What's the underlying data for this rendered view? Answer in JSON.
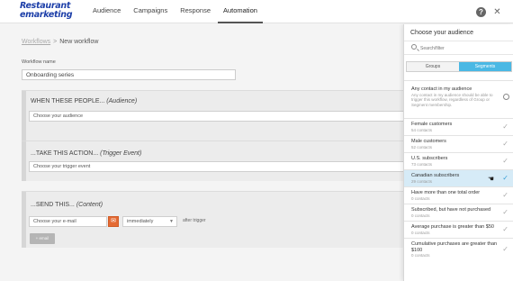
{
  "app": {
    "logo_line1": "Restaurant",
    "logo_line2": "emarketing"
  },
  "nav": {
    "items": [
      "Audience",
      "Campaigns",
      "Response",
      "Automation"
    ],
    "active": "Automation"
  },
  "breadcrumb": {
    "link": "Workflows",
    "separator": ">",
    "current": "New workflow"
  },
  "workflow": {
    "name_label": "Workflow name",
    "name_value": "Onboarding series"
  },
  "sections": {
    "audience": {
      "title_lead": "WHEN THESE PEOPLE...",
      "title_tag": "(Audience)",
      "field_value": "Choose your audience"
    },
    "trigger": {
      "title_lead": "...TAKE THIS ACTION...",
      "title_tag": "(Trigger Event)",
      "field_value": "Choose your trigger event"
    },
    "content": {
      "title_lead": "...SEND THIS...",
      "title_tag": "(Content)",
      "email_placeholder": "Choose your e-mail",
      "timing_value": "immediately",
      "after_trigger": "after trigger",
      "add_button": "+ email"
    }
  },
  "panel": {
    "title": "Choose your audience",
    "search_placeholder": "Search/filter",
    "tabs": [
      "Groups",
      "Segments"
    ],
    "active_tab": "Segments",
    "any_contact": {
      "title": "Any contact in my audience",
      "desc": "Any contact in my audience should be able to trigger this workflow, regardless of Group or Segment membership."
    },
    "segments": [
      {
        "title": "Female customers",
        "count": "54 contacts"
      },
      {
        "title": "Male customers",
        "count": "52 contacts"
      },
      {
        "title": "U.S. subscribers",
        "count": "73 contacts"
      },
      {
        "title": "Canadian subscribers",
        "count": "29 contacts",
        "selected": true
      },
      {
        "title": "Have more than one total order",
        "count": "0 contacts"
      },
      {
        "title": "Subscribed, but have not purchased",
        "count": "0 contacts"
      },
      {
        "title": "Average purchase is greater than $50",
        "count": "0 contacts"
      },
      {
        "title": "Cumulative purchases are greater than $100",
        "count": "0 contacts"
      }
    ]
  },
  "colors": {
    "accent": "#4ab8e4",
    "selected_row": "#d6ebf7",
    "email_icon": "#e46a33",
    "logo_blue": "#1c3ea8",
    "logo_red": "#d8262b"
  },
  "icons": [
    "help-icon",
    "tools-icon",
    "search-icon",
    "mail-icon",
    "chevron-down-icon",
    "check-icon",
    "radio-icon",
    "cursor-icon"
  ]
}
